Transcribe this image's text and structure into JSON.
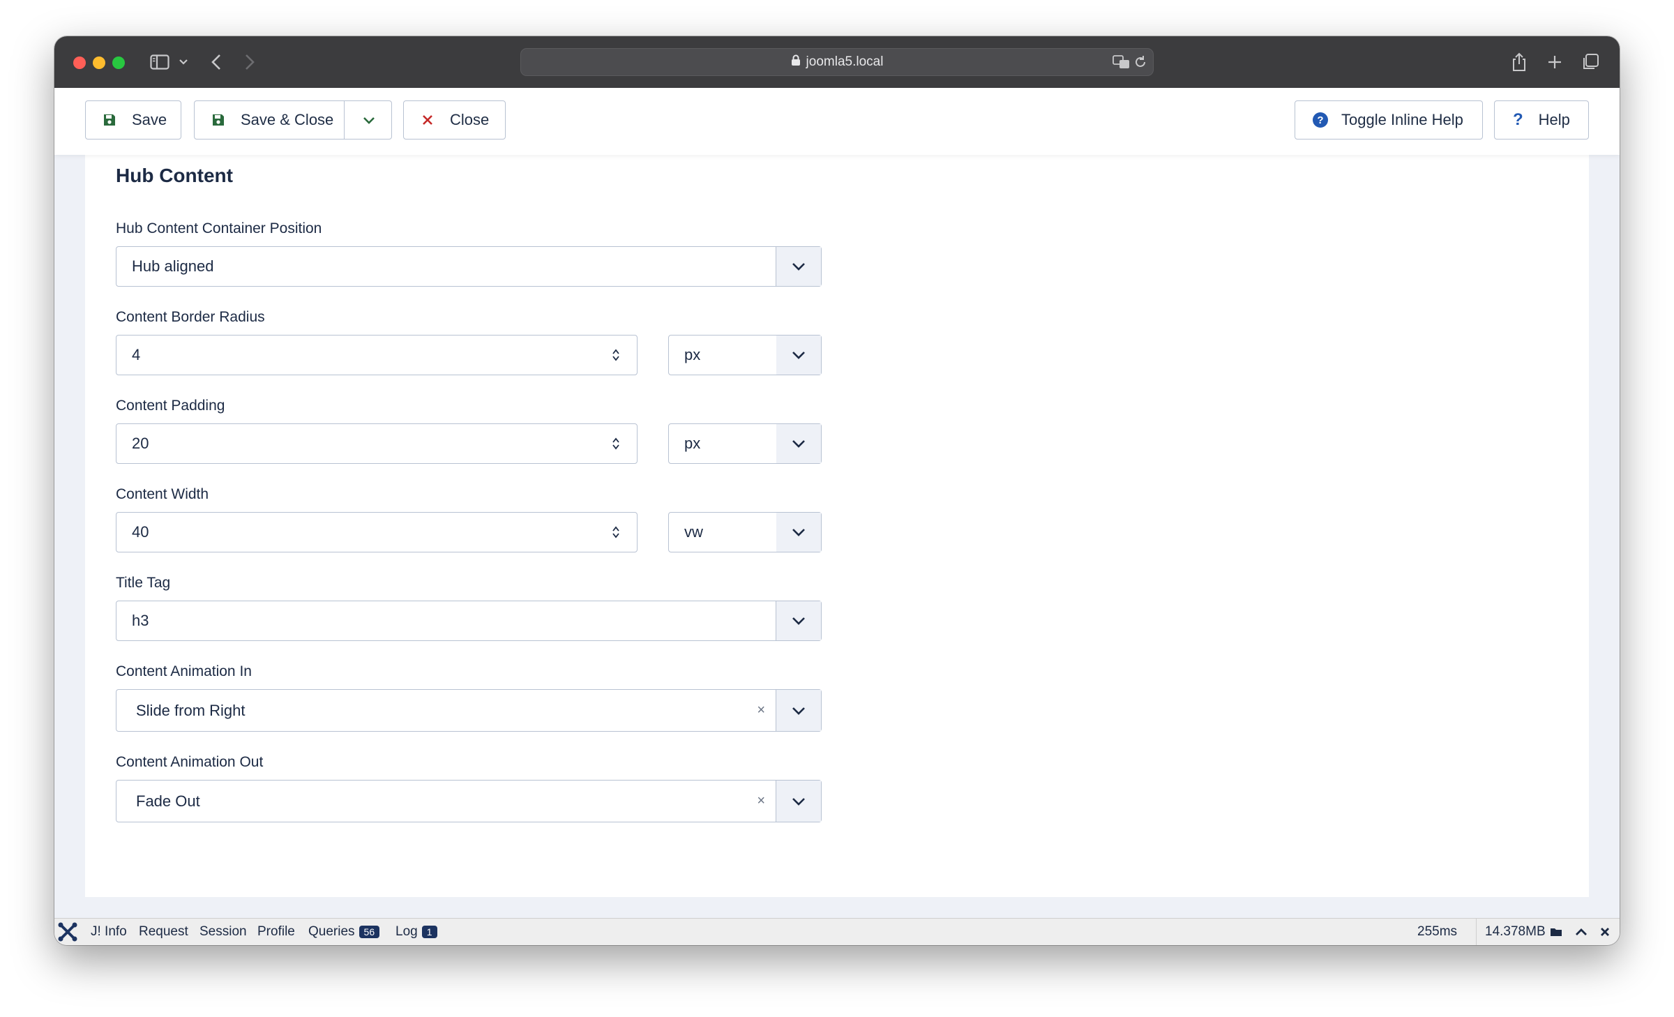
{
  "browser": {
    "url": "joomla5.local"
  },
  "toolbar": {
    "save_label": "Save",
    "save_close_label": "Save & Close",
    "close_label": "Close",
    "toggle_help_label": "Toggle Inline Help",
    "help_label": "Help"
  },
  "section": {
    "title": "Hub Content"
  },
  "fields": {
    "container_position": {
      "label": "Hub Content Container Position",
      "value": "Hub aligned"
    },
    "border_radius": {
      "label": "Content Border Radius",
      "value": "4",
      "unit": "px"
    },
    "padding": {
      "label": "Content Padding",
      "value": "20",
      "unit": "px"
    },
    "width": {
      "label": "Content Width",
      "value": "40",
      "unit": "vw"
    },
    "title_tag": {
      "label": "Title Tag",
      "value": "h3"
    },
    "animation_in": {
      "label": "Content Animation In",
      "value": "Slide from Right"
    },
    "animation_out": {
      "label": "Content Animation Out",
      "value": "Fade Out"
    }
  },
  "debugbar": {
    "info": "J! Info",
    "request": "Request",
    "session": "Session",
    "profile": "Profile",
    "queries": "Queries",
    "queries_count": "56",
    "log": "Log",
    "log_count": "1",
    "time": "255ms",
    "memory": "14.378MB"
  }
}
